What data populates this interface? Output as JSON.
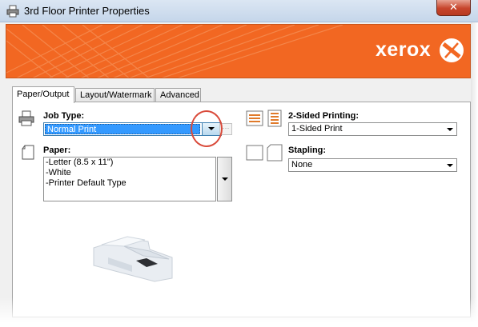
{
  "window": {
    "title": "3rd Floor Printer Properties",
    "close_label": "✕"
  },
  "banner": {
    "brand": "xerox",
    "brand_color": "#f26722"
  },
  "tabs": [
    {
      "label": "Paper/Output",
      "active": true
    },
    {
      "label": "Layout/Watermark",
      "active": false
    },
    {
      "label": "Advanced",
      "active": false
    }
  ],
  "job_type": {
    "label": "Job Type:",
    "value": "Normal Print",
    "more_label": "···"
  },
  "paper": {
    "label": "Paper:",
    "lines": [
      "-Letter (8.5 x 11\")",
      "-White",
      "-Printer Default Type"
    ]
  },
  "two_sided": {
    "label": "2-Sided Printing:",
    "value": "1-Sided Print"
  },
  "stapling": {
    "label": "Stapling:",
    "value": "None"
  }
}
